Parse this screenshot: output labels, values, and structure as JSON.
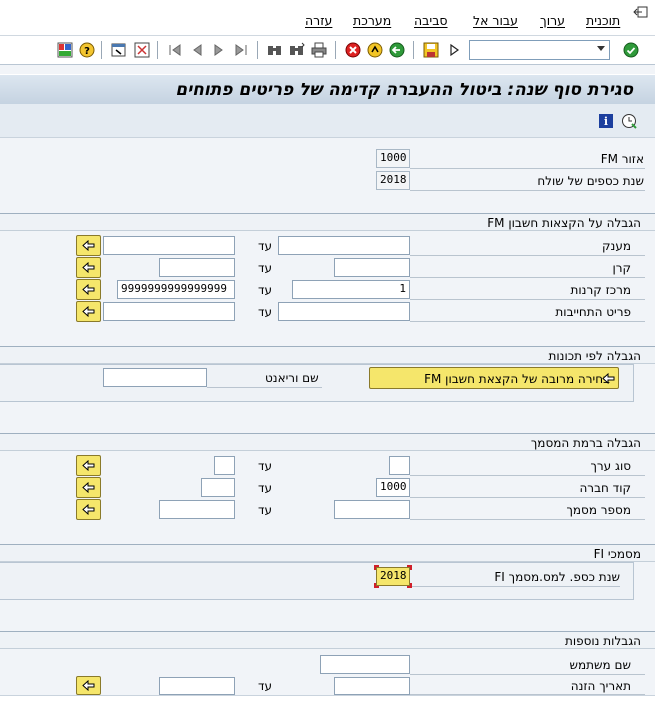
{
  "menu": {
    "program": "תוכנית",
    "edit": "ערוך",
    "goto": "עבור אל",
    "environment": "סביבה",
    "system": "מערכת",
    "help": "עזרה"
  },
  "toolbar": {
    "command_field": ""
  },
  "title": "סגירת סוף שנה: ביטול ההעברה קדימה של פריטים פתוחים",
  "header_fields": {
    "fm_area_label": "אזור FM",
    "fm_area_value": "1000",
    "sender_fy_label": "שנת כספים של שולח",
    "sender_fy_value": "2018"
  },
  "section_fm_account": {
    "title": "הגבלה על הקצאות חשבון FM",
    "to_label": "עד",
    "rows": [
      {
        "label": "מענק",
        "from": "",
        "to": ""
      },
      {
        "label": "קרן",
        "from": "",
        "to": ""
      },
      {
        "label": "מרכז קרנות",
        "from": "1",
        "to": "9999999999999999"
      },
      {
        "label": "פריט התחייבות",
        "from": "",
        "to": ""
      }
    ]
  },
  "section_plans": {
    "title": "הגבלה לפי תכונות",
    "multi_select_button": "בחירה מרובה של הקצאת חשבון FM",
    "variant_label": "שם וריאנט",
    "variant_value": ""
  },
  "section_document": {
    "title": "הגבלה ברמת המסמך",
    "to_label": "עד",
    "rows": [
      {
        "label": "סוג ערך",
        "from": "",
        "to": ""
      },
      {
        "label": "קוד חברה",
        "from": "1000",
        "to": ""
      },
      {
        "label": "מספר מסמך",
        "from": "",
        "to": ""
      }
    ]
  },
  "section_fi": {
    "title": "מסמכי FI",
    "fy_label": "שנת כספ. למס.מסמך FI",
    "fy_value": "2018"
  },
  "section_additional": {
    "title": "הגבלות נוספות",
    "to_label": "עד",
    "username_label": "שם משתמש",
    "username_value": "",
    "entry_date_label": "תאריך הזנה",
    "entry_date_from": "",
    "entry_date_to": ""
  },
  "colors": {
    "accent_yellow": "#f5e66b",
    "title_gradient_top": "#dce6f0",
    "focus_red": "#d0202a"
  }
}
